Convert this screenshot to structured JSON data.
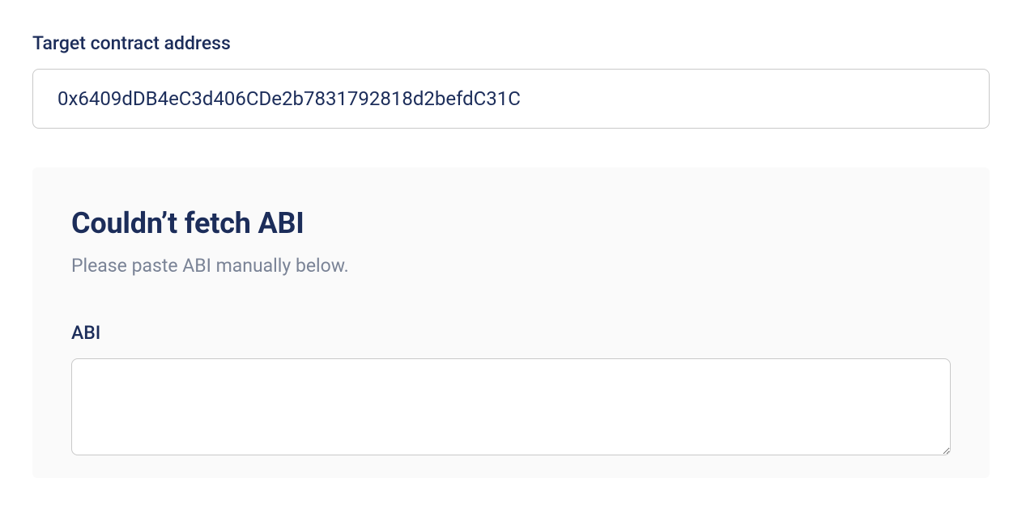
{
  "form": {
    "contract_address": {
      "label": "Target contract address",
      "value": "0x6409dDB4eC3d406CDe2b7831792818d2befdC31C"
    }
  },
  "panel": {
    "heading": "Couldn’t fetch ABI",
    "subtext": "Please paste ABI manually below.",
    "abi": {
      "label": "ABI",
      "value": ""
    }
  }
}
